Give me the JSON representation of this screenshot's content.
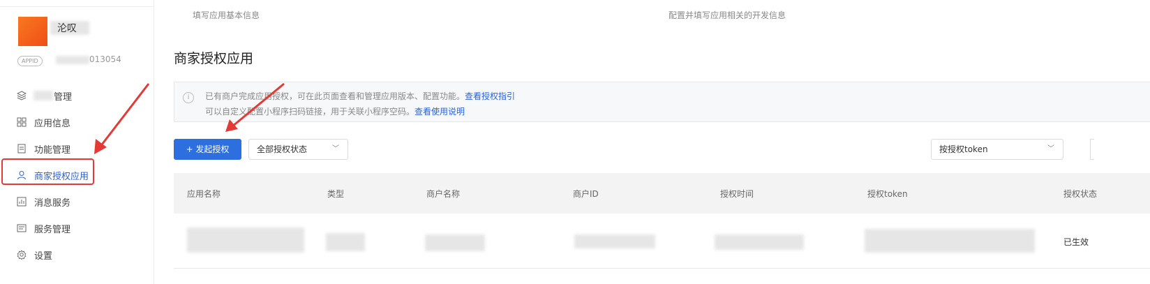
{
  "sidebar": {
    "app_name_tail": "沦叹",
    "appid_badge": "APPID",
    "appid_suffix": "013054",
    "items": [
      {
        "label": "管理",
        "icon": "layers-icon"
      },
      {
        "label": "应用信息",
        "icon": "grid-icon"
      },
      {
        "label": "功能管理",
        "icon": "document-icon"
      },
      {
        "label": "商家授权应用",
        "icon": "user-icon",
        "active": true
      },
      {
        "label": "消息服务",
        "icon": "chart-icon"
      },
      {
        "label": "服务管理",
        "icon": "list-icon"
      },
      {
        "label": "设置",
        "icon": "gear-icon"
      }
    ]
  },
  "steps": {
    "step1": "填写应用基本信息",
    "step2": "配置并填写应用相关的开发信息"
  },
  "page": {
    "title": "商家授权应用"
  },
  "info": {
    "line1": "已有商户完成应用授权，可在此页面查看和管理应用版本、配置功能。",
    "line1_link": "查看授权指引",
    "line2": "可以自定义配置小程序扫码链接，用于关联小程序空码。",
    "line2_link": "查看使用说明"
  },
  "toolbar": {
    "primary_button": "+ 发起授权",
    "status_select": "全部授权状态",
    "token_select": "按授权token"
  },
  "table": {
    "headers": [
      "应用名称",
      "类型",
      "商户名称",
      "商户ID",
      "授权时间",
      "授权token",
      "授权状态"
    ],
    "rows": [
      {
        "status": "已生效"
      }
    ]
  },
  "colors": {
    "accent": "#2d6fde",
    "highlight": "#e53935",
    "logo": "#f26522"
  }
}
